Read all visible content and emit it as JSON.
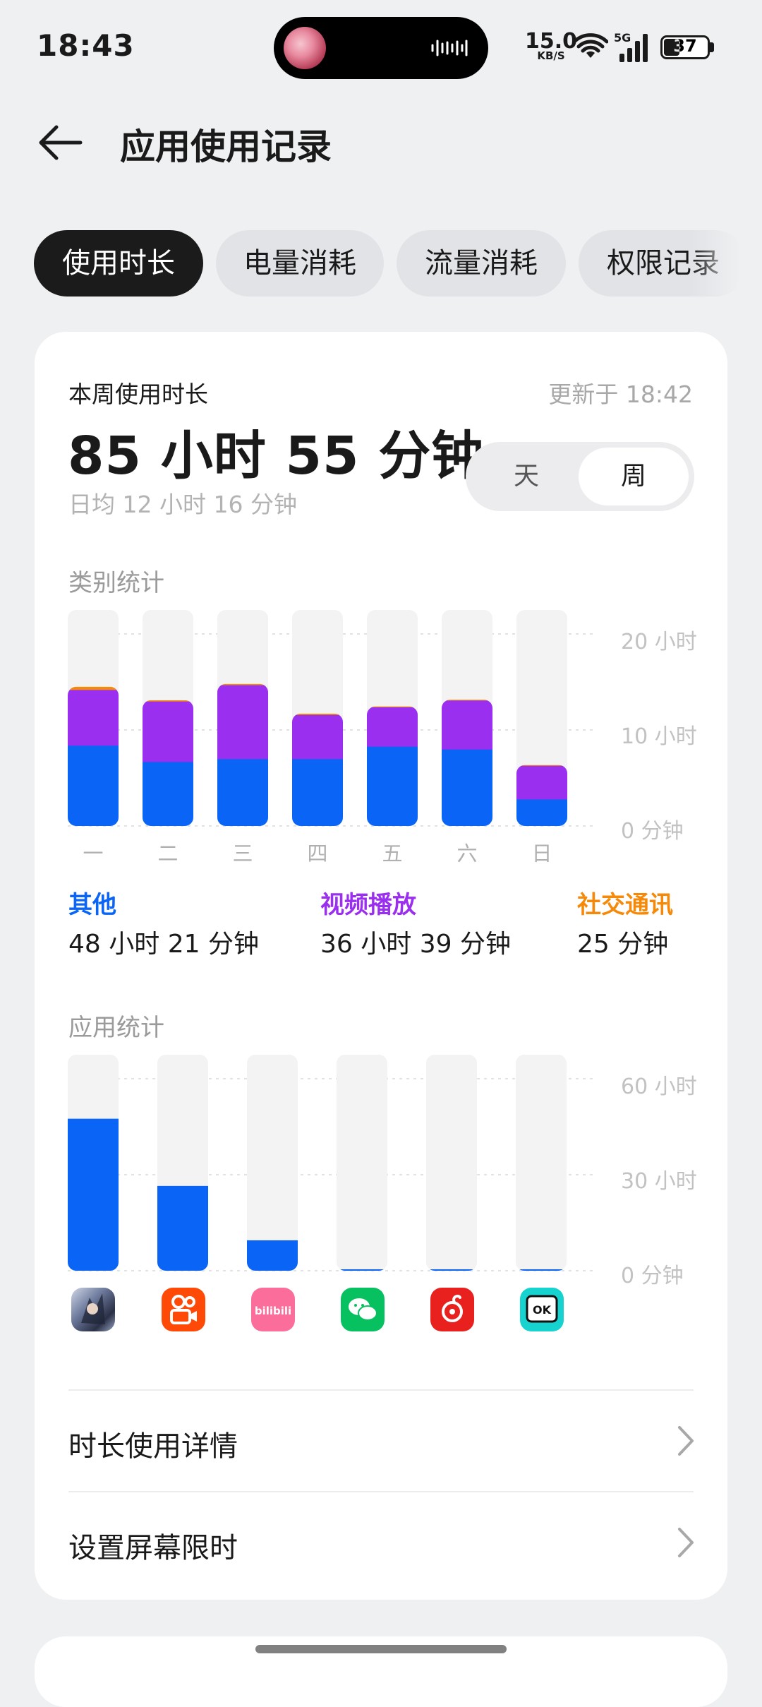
{
  "status_bar": {
    "time": "18:43",
    "net_speed": "15.0",
    "net_speed_unit": "KB/S",
    "cell_label": "5G",
    "battery_percent": "37",
    "battery_level": 0.37
  },
  "header": {
    "title": "应用使用记录",
    "back_icon": "arrow-left-icon"
  },
  "tabs": [
    {
      "label": "使用时长",
      "active": true
    },
    {
      "label": "电量消耗",
      "active": false
    },
    {
      "label": "流量消耗",
      "active": false
    },
    {
      "label": "权限记录",
      "active": false
    }
  ],
  "summary": {
    "heading": "本周使用时长",
    "updated": "更新于 18:42",
    "total": "85 小时 55 分钟",
    "daily_avg": "日均 12 小时 16 分钟",
    "period_toggle": {
      "options": [
        "天",
        "周"
      ],
      "selected": "周"
    }
  },
  "category_chart": {
    "label": "类别统计",
    "y_ticks": [
      "20 小时",
      "10 小时",
      "0 分钟"
    ],
    "legend": [
      {
        "name": "其他",
        "value": "48 小时 21 分钟",
        "color": "#0a64f5"
      },
      {
        "name": "视频播放",
        "value": "36 小时 39 分钟",
        "color": "#9b2ff0"
      },
      {
        "name": "社交通讯",
        "value": "25 分钟",
        "color": "#f58a0a"
      }
    ]
  },
  "chart_data": [
    {
      "type": "bar",
      "stacked": true,
      "categories": [
        "一",
        "二",
        "三",
        "四",
        "五",
        "六",
        "日"
      ],
      "ylim": [
        0,
        22.5
      ],
      "y_unit": "小时",
      "series": [
        {
          "name": "其他",
          "values": [
            8.4,
            6.7,
            7.0,
            7.0,
            8.3,
            8.0,
            2.8
          ]
        },
        {
          "name": "视频播放",
          "values": [
            5.8,
            6.3,
            7.7,
            4.6,
            4.1,
            5.1,
            3.5
          ]
        },
        {
          "name": "社交通讯",
          "values": [
            0.3,
            0.1,
            0.1,
            0.1,
            0.05,
            0.05,
            0.05
          ]
        }
      ]
    },
    {
      "type": "bar",
      "categories": [
        "app-1",
        "kuaishou",
        "bilibili",
        "wechat",
        "netease-music",
        "app-6"
      ],
      "ylim": [
        0,
        67.5
      ],
      "y_unit": "小时",
      "values": [
        47.5,
        26.5,
        9.5,
        0.4,
        0.4,
        0.3
      ]
    }
  ],
  "app_chart": {
    "label": "应用统计",
    "y_ticks": [
      "60 小时",
      "30 小时",
      "0 分钟"
    ],
    "apps": [
      {
        "icon": "game-character-icon"
      },
      {
        "icon": "kuaishou-icon"
      },
      {
        "icon": "bilibili-icon",
        "text": "bilibili"
      },
      {
        "icon": "wechat-icon"
      },
      {
        "icon": "netease-music-icon"
      },
      {
        "icon": "ok-app-icon",
        "text": "OK"
      }
    ]
  },
  "links": [
    {
      "label": "时长使用详情"
    },
    {
      "label": "设置屏幕限时"
    }
  ],
  "colors": {
    "other": "#0a64f5",
    "video": "#9b2ff0",
    "social": "#f58a0a",
    "track": "#f3f3f4"
  }
}
